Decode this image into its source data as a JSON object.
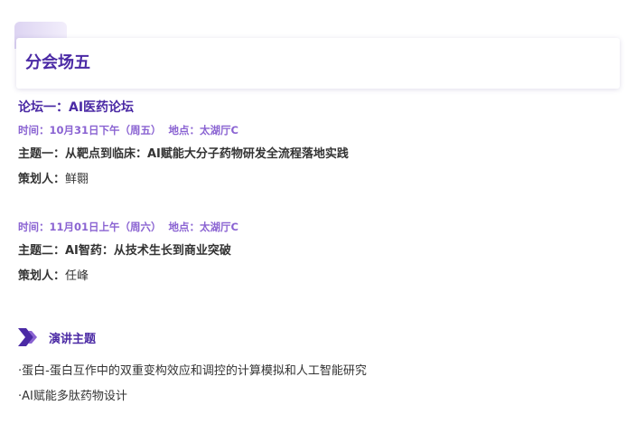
{
  "section": {
    "title": "分会场五"
  },
  "forum": {
    "title": "论坛一：AI医药论坛"
  },
  "sessions": [
    {
      "time_label": "时间：",
      "time": "10月31日下午（周五）",
      "location_label": "地点：",
      "location": "太湖厅C",
      "topic": "主题一：从靶点到临床：AI赋能大分子药物研发全流程落地实践",
      "planner_label": "策划人：",
      "planner": "鲜翾"
    },
    {
      "time_label": "时间：",
      "time": "11月01日上午（周六）",
      "location_label": "地点：",
      "location": "太湖厅C",
      "topic": "主题二：AI智药：从技术生长到商业突破",
      "planner_label": "策划人：",
      "planner": "任峰"
    }
  ],
  "speech": {
    "icon": "double-chevron-icon",
    "heading": "演讲主题",
    "items": [
      "·蛋白-蛋白互作中的双重变构效应和调控的计算模拟和人工智能研究",
      "·AI赋能多肽药物设计"
    ]
  },
  "colors": {
    "accent": "#4b2aa5",
    "meta": "#8a63d2",
    "text": "#333333"
  }
}
